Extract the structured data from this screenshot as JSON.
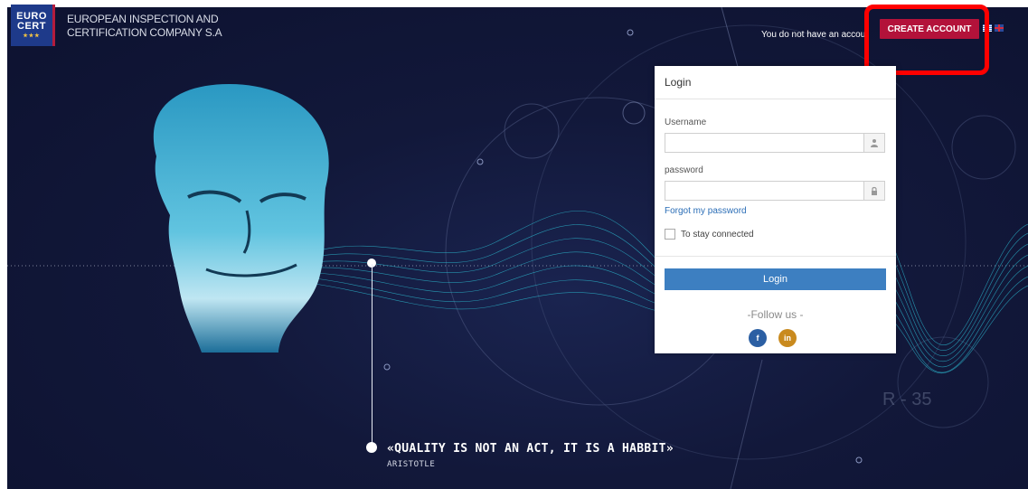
{
  "brand": {
    "logo_line1": "EURO",
    "logo_line2": "CERT",
    "company_line1": "EUROPEAN INSPECTION AND",
    "company_line2": "CERTIFICATION COMPANY S.A"
  },
  "header": {
    "no_account_text": "You do not have an accou",
    "create_account_label": "CREATE ACCOUNT",
    "languages": [
      "greek-flag-icon",
      "uk-flag-icon"
    ]
  },
  "login": {
    "title": "Login",
    "username_label": "Username",
    "username_value": "",
    "password_label": "password",
    "password_value": "",
    "forgot_label": "Forgot my password",
    "remember_label": "To stay connected",
    "remember_checked": false,
    "submit_label": "Login",
    "follow_label": "-Follow us -",
    "social": [
      {
        "name": "facebook-icon",
        "glyph": "f",
        "color": "#2b5fa3"
      },
      {
        "name": "linkedin-icon",
        "glyph": "in",
        "color": "#c98a1e"
      }
    ]
  },
  "quote": {
    "text": "«QUALITY IS NOT AN ACT, IT IS A HABBIT»",
    "author": "ARISTOTLE"
  },
  "decor": {
    "corner_label": "R - 35",
    "highlight_color": "#ff0000",
    "accent_color": "#b3123a",
    "button_color": "#3d7fc1"
  }
}
